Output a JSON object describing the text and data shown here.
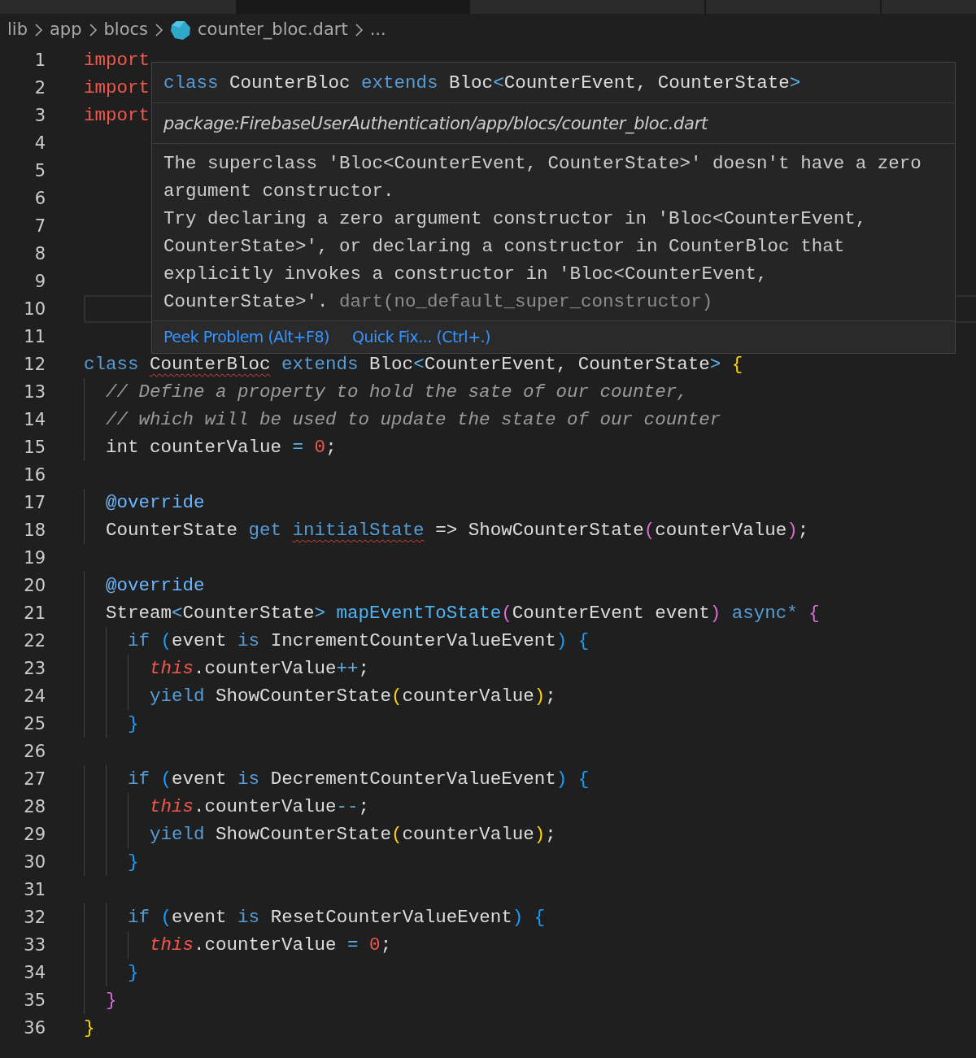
{
  "breadcrumbs": [
    {
      "label": "lib",
      "file_icon": false
    },
    {
      "label": "app",
      "file_icon": false
    },
    {
      "label": "blocs",
      "file_icon": false
    },
    {
      "label": "counter_bloc.dart",
      "file_icon": true
    },
    {
      "label": "...",
      "file_icon": false
    }
  ],
  "lines": [
    {
      "number": "1",
      "current": false,
      "tokens": [
        {
          "text": "import",
          "kind": "imp"
        }
      ]
    },
    {
      "number": "2",
      "current": false,
      "tokens": [
        {
          "text": "import",
          "kind": "imp"
        }
      ]
    },
    {
      "number": "3",
      "current": false,
      "tokens": [
        {
          "text": "import",
          "kind": "imp"
        }
      ]
    },
    {
      "number": "4",
      "current": false
    },
    {
      "number": "5",
      "current": false
    },
    {
      "number": "6",
      "current": false
    },
    {
      "number": "7",
      "current": false
    },
    {
      "number": "8",
      "current": false
    },
    {
      "number": "9",
      "current": false
    },
    {
      "number": "10",
      "current": true
    },
    {
      "number": "11",
      "current": false
    },
    {
      "number": "12",
      "current": false,
      "tokens": [
        {
          "text": "class",
          "kind": "kw"
        },
        {
          "text": " CounterBloc",
          "kind": "plain",
          "squiggle": true
        },
        {
          "text": " extends",
          "kind": "kw"
        },
        {
          "text": " Bloc",
          "kind": "plain"
        },
        {
          "text": "<",
          "kind": "op"
        },
        {
          "text": "CounterEvent, CounterState",
          "kind": "plain"
        },
        {
          "text": ">",
          "kind": "op"
        },
        {
          "text": " {",
          "kind": "by"
        }
      ]
    },
    {
      "number": "13",
      "current": false,
      "tokens": [
        {
          "text": "  // Define a property to hold the sate of our counter,",
          "kind": "cm"
        }
      ]
    },
    {
      "number": "14",
      "current": false,
      "tokens": [
        {
          "text": "  // which will be used to update the state of our counter",
          "kind": "cm"
        }
      ]
    },
    {
      "number": "15",
      "current": false,
      "tokens": [
        {
          "text": "  int counterValue",
          "kind": "plain"
        },
        {
          "text": " =",
          "kind": "op"
        },
        {
          "text": " 0",
          "kind": "num"
        },
        {
          "text": ";",
          "kind": "plain"
        }
      ]
    },
    {
      "number": "16",
      "current": false
    },
    {
      "number": "17",
      "current": false,
      "tokens": [
        {
          "text": "  @override",
          "kind": "ann"
        }
      ]
    },
    {
      "number": "18",
      "current": false,
      "tokens": [
        {
          "text": "  CounterState",
          "kind": "plain"
        },
        {
          "text": " get",
          "kind": "kw"
        },
        {
          "text": " initialState",
          "kind": "kw",
          "squiggle": true
        },
        {
          "text": " => ShowCounterState",
          "kind": "plain"
        },
        {
          "text": "(",
          "kind": "bm"
        },
        {
          "text": "counterValue",
          "kind": "plain"
        },
        {
          "text": ")",
          "kind": "bm"
        },
        {
          "text": ";",
          "kind": "plain"
        }
      ]
    },
    {
      "number": "19",
      "current": false
    },
    {
      "number": "20",
      "current": false,
      "tokens": [
        {
          "text": "  @override",
          "kind": "ann"
        }
      ]
    },
    {
      "number": "21",
      "current": false,
      "tokens": [
        {
          "text": "  Stream",
          "kind": "plain"
        },
        {
          "text": "<",
          "kind": "op"
        },
        {
          "text": "CounterState",
          "kind": "plain"
        },
        {
          "text": ">",
          "kind": "op"
        },
        {
          "text": " mapEventToState",
          "kind": "fn"
        },
        {
          "text": "(",
          "kind": "bm"
        },
        {
          "text": "CounterEvent event",
          "kind": "plain"
        },
        {
          "text": ")",
          "kind": "bm"
        },
        {
          "text": " async*",
          "kind": "kw"
        },
        {
          "text": " {",
          "kind": "bm"
        }
      ]
    },
    {
      "number": "22",
      "current": false,
      "tokens": [
        {
          "text": "    if",
          "kind": "kw"
        },
        {
          "text": " (",
          "kind": "bb"
        },
        {
          "text": "event",
          "kind": "plain"
        },
        {
          "text": " is",
          "kind": "kw"
        },
        {
          "text": " IncrementCounterValueEvent",
          "kind": "plain"
        },
        {
          "text": ")",
          "kind": "bb"
        },
        {
          "text": " {",
          "kind": "bb"
        }
      ]
    },
    {
      "number": "23",
      "current": false,
      "tokens": [
        {
          "text": "      this",
          "kind": "this"
        },
        {
          "text": ".counterValue",
          "kind": "plain"
        },
        {
          "text": "++",
          "kind": "op"
        },
        {
          "text": ";",
          "kind": "plain"
        }
      ]
    },
    {
      "number": "24",
      "current": false,
      "tokens": [
        {
          "text": "      yield",
          "kind": "kw"
        },
        {
          "text": " ShowCounterState",
          "kind": "plain"
        },
        {
          "text": "(",
          "kind": "by"
        },
        {
          "text": "counterValue",
          "kind": "plain"
        },
        {
          "text": ")",
          "kind": "by"
        },
        {
          "text": ";",
          "kind": "plain"
        }
      ]
    },
    {
      "number": "25",
      "current": false,
      "tokens": [
        {
          "text": "    }",
          "kind": "bb"
        }
      ]
    },
    {
      "number": "26",
      "current": false
    },
    {
      "number": "27",
      "current": false,
      "tokens": [
        {
          "text": "    if",
          "kind": "kw"
        },
        {
          "text": " (",
          "kind": "bb"
        },
        {
          "text": "event",
          "kind": "plain"
        },
        {
          "text": " is",
          "kind": "kw"
        },
        {
          "text": " DecrementCounterValueEvent",
          "kind": "plain"
        },
        {
          "text": ")",
          "kind": "bb"
        },
        {
          "text": " {",
          "kind": "bb"
        }
      ]
    },
    {
      "number": "28",
      "current": false,
      "tokens": [
        {
          "text": "      this",
          "kind": "this"
        },
        {
          "text": ".counterValue",
          "kind": "plain"
        },
        {
          "text": "--",
          "kind": "op"
        },
        {
          "text": ";",
          "kind": "plain"
        }
      ]
    },
    {
      "number": "29",
      "current": false,
      "tokens": [
        {
          "text": "      yield",
          "kind": "kw"
        },
        {
          "text": " ShowCounterState",
          "kind": "plain"
        },
        {
          "text": "(",
          "kind": "by"
        },
        {
          "text": "counterValue",
          "kind": "plain"
        },
        {
          "text": ")",
          "kind": "by"
        },
        {
          "text": ";",
          "kind": "plain"
        }
      ]
    },
    {
      "number": "30",
      "current": false,
      "tokens": [
        {
          "text": "    }",
          "kind": "bb"
        }
      ]
    },
    {
      "number": "31",
      "current": false
    },
    {
      "number": "32",
      "current": false,
      "tokens": [
        {
          "text": "    if",
          "kind": "kw"
        },
        {
          "text": " (",
          "kind": "bb"
        },
        {
          "text": "event",
          "kind": "plain"
        },
        {
          "text": " is",
          "kind": "kw"
        },
        {
          "text": " ResetCounterValueEvent",
          "kind": "plain"
        },
        {
          "text": ")",
          "kind": "bb"
        },
        {
          "text": " {",
          "kind": "bb"
        }
      ]
    },
    {
      "number": "33",
      "current": false,
      "tokens": [
        {
          "text": "      this",
          "kind": "this"
        },
        {
          "text": ".counterValue",
          "kind": "plain"
        },
        {
          "text": " =",
          "kind": "op"
        },
        {
          "text": " 0",
          "kind": "num"
        },
        {
          "text": ";",
          "kind": "plain"
        }
      ]
    },
    {
      "number": "34",
      "current": false,
      "tokens": [
        {
          "text": "    }",
          "kind": "bb"
        }
      ]
    },
    {
      "number": "35",
      "current": false,
      "tokens": [
        {
          "text": "  }",
          "kind": "bm"
        }
      ]
    },
    {
      "number": "36",
      "current": false,
      "tokens": [
        {
          "text": "}",
          "kind": "by"
        }
      ]
    }
  ],
  "hover": {
    "signature": [
      {
        "text": "class",
        "kind": "kw"
      },
      {
        "text": " CounterBloc",
        "kind": "plain"
      },
      {
        "text": " extends",
        "kind": "kw"
      },
      {
        "text": " Bloc",
        "kind": "plain"
      },
      {
        "text": "<",
        "kind": "op"
      },
      {
        "text": "CounterEvent, CounterState",
        "kind": "plain"
      },
      {
        "text": ">",
        "kind": "op"
      }
    ],
    "path": "package:FirebaseUserAuthentication/app/blocs/counter_bloc.dart",
    "message_lines": [
      "The superclass 'Bloc<CounterEvent, CounterState>' doesn't have a zero",
      "argument constructor.",
      "Try declaring a zero argument constructor in 'Bloc<CounterEvent,",
      "CounterState>', or declaring a constructor in CounterBloc that",
      "explicitly invokes a constructor in 'Bloc<CounterEvent,",
      "CounterState>'."
    ],
    "source": "dart(no_default_super_constructor)",
    "actions": [
      "Peek Problem (Alt+F8)",
      "Quick Fix... (Ctrl+.)"
    ]
  }
}
